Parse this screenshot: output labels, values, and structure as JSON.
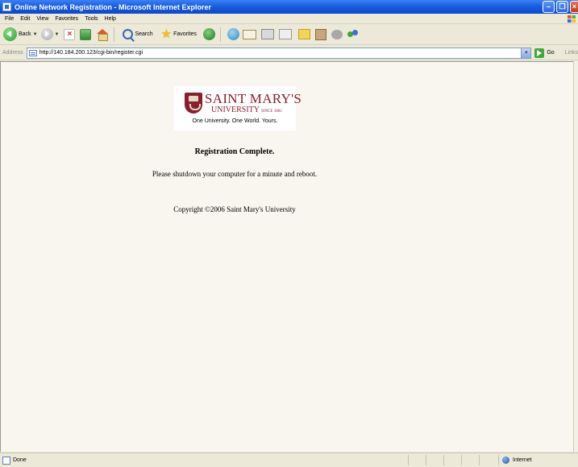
{
  "window": {
    "title": "Online Network Registration - Microsoft Internet Explorer",
    "controls": [
      "minimize",
      "maximize",
      "close"
    ]
  },
  "menubar": {
    "items": [
      "File",
      "Edit",
      "View",
      "Favorites",
      "Tools",
      "Help"
    ]
  },
  "toolbar": {
    "back_label": "Back",
    "search_label": "Search",
    "favorites_label": "Favorites"
  },
  "addressbar": {
    "label": "Address",
    "url": "http://140.184.200.123/cgi-bin/register.cgi",
    "go_label": "Go",
    "links_label": "Links"
  },
  "page": {
    "logo": {
      "name": "SAINT MARY'S",
      "sub": "UNIVERSITY",
      "since": "SINCE 1802",
      "tagline": "One University. One World. Yours."
    },
    "heading": "Registration Complete.",
    "message": "Please shutdown your computer for a minute and reboot.",
    "copyright": "Copyright ©2006 Saint Mary's University"
  },
  "statusbar": {
    "text": "Done",
    "zone": "Internet"
  },
  "colors": {
    "titlebar": "#0A48C9",
    "chrome": "#ECE9D8",
    "page_background": "#F8F6EE",
    "brand": "#8A1F2E"
  }
}
